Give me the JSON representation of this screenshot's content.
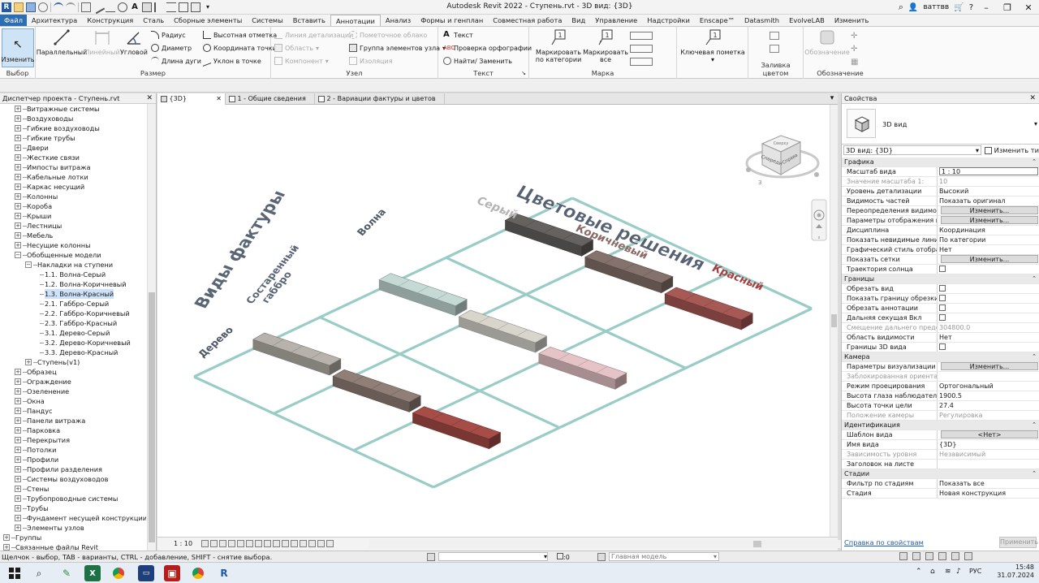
{
  "window": {
    "title": "Autodesk Revit 2022 - Ступень.rvt - 3D вид: {3D}",
    "user": "ваттвв",
    "minimize": "–",
    "restore": "❐",
    "close": "✕"
  },
  "tabs": [
    "Файл",
    "Архитектура",
    "Конструкция",
    "Сталь",
    "Сборные элементы",
    "Системы",
    "Вставить",
    "Аннотации",
    "Анализ",
    "Формы и генплан",
    "Совместная работа",
    "Вид",
    "Управление",
    "Надстройки",
    "Enscape™",
    "Datasmith",
    "EvolveLAB",
    "Изменить"
  ],
  "active_tab": "Аннотации",
  "ribbon": {
    "select": {
      "button": "Изменить",
      "label": "Выбор"
    },
    "dimension": {
      "parallel": "Параллельный",
      "linear": "Линейный",
      "angular": "Угловой",
      "radius": "Радиус",
      "diameter": "Диаметр",
      "arc_length": "Длина дуги",
      "spot_elevation": "Высотная отметка",
      "spot_coordinate": "Координата точки",
      "spot_slope": "Уклон  в точке",
      "label": "Размер"
    },
    "detail": {
      "detail_line": "Линия детализации",
      "region": "Область",
      "component": "Компонент",
      "revision_cloud": "Пометочное облако",
      "detail_group": "Группа элементов узла",
      "insulation": "Изоляция",
      "label": "Узел"
    },
    "text": {
      "text": "Текст",
      "spelling": "Проверка  орфографии",
      "find_replace": "Найти/ Заменить",
      "label": "Текст"
    },
    "tag": {
      "by_category": "Маркировать по категории",
      "all": "Маркировать все",
      "label": "Марка"
    },
    "keynote": {
      "button": "Ключевая пометка"
    },
    "color_fill": {
      "label": "Заливка цветом"
    },
    "symbol": {
      "button": "Обозначение",
      "label": "Обозначение"
    }
  },
  "project_browser": {
    "title": "Диспетчер проекта - Ступень.rvt",
    "close": "✕",
    "items": [
      {
        "label": "Витражные системы",
        "level": 1,
        "toggle": "+"
      },
      {
        "label": "Воздуховоды",
        "level": 1,
        "toggle": "+"
      },
      {
        "label": "Гибкие воздуховоды",
        "level": 1,
        "toggle": "+"
      },
      {
        "label": "Гибкие трубы",
        "level": 1,
        "toggle": "+"
      },
      {
        "label": "Двери",
        "level": 1,
        "toggle": "+"
      },
      {
        "label": "Жесткие связи",
        "level": 1,
        "toggle": "+"
      },
      {
        "label": "Импосты витража",
        "level": 1,
        "toggle": "+"
      },
      {
        "label": "Кабельные лотки",
        "level": 1,
        "toggle": "+"
      },
      {
        "label": "Каркас несущий",
        "level": 1,
        "toggle": "+"
      },
      {
        "label": "Колонны",
        "level": 1,
        "toggle": "+"
      },
      {
        "label": "Короба",
        "level": 1,
        "toggle": "+"
      },
      {
        "label": "Крыши",
        "level": 1,
        "toggle": "+"
      },
      {
        "label": "Лестницы",
        "level": 1,
        "toggle": "+"
      },
      {
        "label": "Мебель",
        "level": 1,
        "toggle": "+"
      },
      {
        "label": "Несущие колонны",
        "level": 1,
        "toggle": "+"
      },
      {
        "label": "Обобщенные модели",
        "level": 1,
        "toggle": "−"
      },
      {
        "label": "Накладки на ступени",
        "level": 2,
        "toggle": "−"
      },
      {
        "label": "1.1. Волна-Серый",
        "level": 3,
        "toggle": ""
      },
      {
        "label": "1.2. Волна-Коричневый",
        "level": 3,
        "toggle": ""
      },
      {
        "label": "1.3. Волна-Красный",
        "level": 3,
        "toggle": "",
        "selected": true
      },
      {
        "label": "2.1. Габбро-Серый",
        "level": 3,
        "toggle": ""
      },
      {
        "label": "2.2. Габбро-Коричневый",
        "level": 3,
        "toggle": ""
      },
      {
        "label": "2.3. Габбро-Красный",
        "level": 3,
        "toggle": ""
      },
      {
        "label": "3.1. Дерево-Серый",
        "level": 3,
        "toggle": ""
      },
      {
        "label": "3.2. Дерево-Коричневый",
        "level": 3,
        "toggle": ""
      },
      {
        "label": "3.3. Дерево-Красный",
        "level": 3,
        "toggle": ""
      },
      {
        "label": "Ступень(v1)",
        "level": 2,
        "toggle": "+"
      },
      {
        "label": "Образец",
        "level": 1,
        "toggle": "+"
      },
      {
        "label": "Ограждение",
        "level": 1,
        "toggle": "+"
      },
      {
        "label": "Озеленение",
        "level": 1,
        "toggle": "+"
      },
      {
        "label": "Окна",
        "level": 1,
        "toggle": "+"
      },
      {
        "label": "Пандус",
        "level": 1,
        "toggle": "+"
      },
      {
        "label": "Панели витража",
        "level": 1,
        "toggle": "+"
      },
      {
        "label": "Парковка",
        "level": 1,
        "toggle": "+"
      },
      {
        "label": "Перекрытия",
        "level": 1,
        "toggle": "+"
      },
      {
        "label": "Потолки",
        "level": 1,
        "toggle": "+"
      },
      {
        "label": "Профили",
        "level": 1,
        "toggle": "+"
      },
      {
        "label": "Профили разделения",
        "level": 1,
        "toggle": "+"
      },
      {
        "label": "Системы воздуховодов",
        "level": 1,
        "toggle": "+"
      },
      {
        "label": "Стены",
        "level": 1,
        "toggle": "+"
      },
      {
        "label": "Трубопроводные системы",
        "level": 1,
        "toggle": "+"
      },
      {
        "label": "Трубы",
        "level": 1,
        "toggle": "+"
      },
      {
        "label": "Фундамент несущей конструкции",
        "level": 1,
        "toggle": "+"
      },
      {
        "label": "Элементы узлов",
        "level": 1,
        "toggle": "+"
      },
      {
        "label": "Группы",
        "level": 0,
        "toggle": "+"
      },
      {
        "label": "Связанные файлы Revit",
        "level": 0,
        "toggle": "+"
      }
    ]
  },
  "view_tabs": [
    {
      "label": "{3D}",
      "close": "✕"
    },
    {
      "label": "1 - Общие сведения",
      "close": ""
    },
    {
      "label": "2 - Вариации фактуры и цветов",
      "close": ""
    }
  ],
  "canvas": {
    "title": "Цветовые решения",
    "rows_title": "Виды фактуры",
    "column_headers": [
      "Серый",
      "Коричневый",
      "Красный"
    ],
    "row_headers": [
      "Волна",
      "Состаренный габбро",
      "Дерево"
    ],
    "viewcube": {
      "left": "Спереди",
      "right": "Справа",
      "top": "Сверху",
      "compass": "З"
    },
    "tile_colors": [
      [
        "#a9a59e",
        "#86766e",
        "#9a4742"
      ],
      [
        "#b6cac5",
        "#c8c5be",
        "#d5b5b8"
      ],
      [
        "#5e5b58",
        "#7b6a64",
        "#9b5250"
      ]
    ],
    "grid_color": "#99ccc6"
  },
  "view_bar": {
    "scale": "1 : 10"
  },
  "properties": {
    "title": "Свойства",
    "close": "✕",
    "type_name": "3D вид",
    "instance": "3D вид: {3D}",
    "edit_type": "Изменить тип",
    "groups": [
      {
        "name": "Графика",
        "rows": [
          {
            "k": "Масштаб вида",
            "v": "1 : 10",
            "kind": "input"
          },
          {
            "k": "Значение масштаба    1:",
            "v": "10",
            "kind": "text",
            "dim": true
          },
          {
            "k": "Уровень детализации",
            "v": "Высокий",
            "kind": "text"
          },
          {
            "k": "Видимость частей",
            "v": "Показать оригинал",
            "kind": "text"
          },
          {
            "k": "Переопределения видимост...",
            "v": "Изменить...",
            "kind": "button"
          },
          {
            "k": "Параметры отображения гр...",
            "v": "Изменить...",
            "kind": "button"
          },
          {
            "k": "Дисциплина",
            "v": "Координация",
            "kind": "text"
          },
          {
            "k": "Показать невидимые линии",
            "v": "По категории",
            "kind": "text"
          },
          {
            "k": "Графический стиль отобра...",
            "v": "Нет",
            "kind": "text"
          },
          {
            "k": "Показать сетки",
            "v": "Изменить...",
            "kind": "button"
          },
          {
            "k": "Траектория солнца",
            "v": "",
            "kind": "checkbox"
          }
        ]
      },
      {
        "name": "Границы",
        "rows": [
          {
            "k": "Обрезать вид",
            "v": "",
            "kind": "checkbox"
          },
          {
            "k": "Показать границу обрезки",
            "v": "",
            "kind": "checkbox"
          },
          {
            "k": "Обрезать аннотации",
            "v": "",
            "kind": "checkbox"
          },
          {
            "k": "Дальняя секущая Вкл",
            "v": "",
            "kind": "checkbox"
          },
          {
            "k": "Смещение дальнего предел...",
            "v": "304800.0",
            "kind": "text",
            "dim": true
          },
          {
            "k": "Область видимости",
            "v": "Нет",
            "kind": "text"
          },
          {
            "k": "Границы 3D вида",
            "v": "",
            "kind": "checkbox"
          }
        ]
      },
      {
        "name": "Камера",
        "rows": [
          {
            "k": "Параметры визуализации",
            "v": "Изменить...",
            "kind": "button"
          },
          {
            "k": "Заблокированная ориентация",
            "v": "",
            "kind": "text",
            "dim": true
          },
          {
            "k": "Режим проецирования",
            "v": "Ортогональный",
            "kind": "text"
          },
          {
            "k": "Высота глаза наблюдателя",
            "v": "1900.5",
            "kind": "text"
          },
          {
            "k": "Высота точки цели",
            "v": "27.4",
            "kind": "text"
          },
          {
            "k": "Положение камеры",
            "v": "Регулировка",
            "kind": "text",
            "dim": true
          }
        ]
      },
      {
        "name": "Идентификация",
        "rows": [
          {
            "k": "Шаблон вида",
            "v": "<Нет>",
            "kind": "button"
          },
          {
            "k": "Имя вида",
            "v": "{3D}",
            "kind": "text"
          },
          {
            "k": "Зависимость уровня",
            "v": "Независимый",
            "kind": "text",
            "dim": true
          },
          {
            "k": "Заголовок на листе",
            "v": "",
            "kind": "text"
          }
        ]
      },
      {
        "name": "Стадии",
        "rows": [
          {
            "k": "Фильтр по стадиям",
            "v": "Показать все",
            "kind": "text"
          },
          {
            "k": "Стадия",
            "v": "Новая конструкция",
            "kind": "text"
          }
        ]
      }
    ],
    "help_link": "Справка по свойствам",
    "apply": "Применить"
  },
  "status": {
    "message": "Щелчок - выбор, TAB - варианты, CTRL - добавление, SHIFT - снятие выбора.",
    "zero": ":0",
    "model": "Главная модель"
  },
  "taskbar": {
    "language": "РУС",
    "time": "15:48",
    "date": "31.07.2024"
  }
}
